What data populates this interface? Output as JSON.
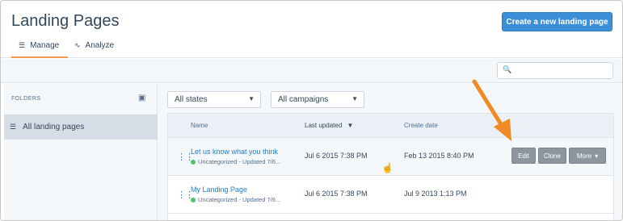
{
  "header": {
    "title": "Landing Pages",
    "create_button": "Create a new landing page",
    "tabs": [
      {
        "label": "Manage",
        "icon": "list-icon",
        "glyph": "☰"
      },
      {
        "label": "Analyze",
        "icon": "activity-icon",
        "glyph": "∿"
      }
    ]
  },
  "toolbar": {
    "search_icon": "🔍",
    "search_placeholder": ""
  },
  "sidebar": {
    "label": "FOLDERS",
    "new_folder_icon": "▣",
    "items": [
      {
        "label": "All landing pages",
        "icon": "☰"
      }
    ]
  },
  "filters": {
    "states": "All states",
    "campaigns": "All campaigns",
    "caret": "▼"
  },
  "table": {
    "columns": {
      "name": "Name",
      "updated": "Last updated",
      "updated_sort": "▼",
      "created": "Create date"
    },
    "rows": [
      {
        "name": "Let us know what you think",
        "meta": "Uncategorized  -  Updated 7/6...",
        "updated": "Jul 6 2015 7:38 PM",
        "created": "Feb 13 2015 8:40 PM"
      },
      {
        "name": "My Landing Page",
        "meta": "Uncategorized  -  Updated 7/6...",
        "updated": "Jul 6 2015 7:38 PM",
        "created": "Jul 9 2013 1:13 PM"
      }
    ],
    "actions": {
      "edit": "Edit",
      "clone": "Clone",
      "more": "More",
      "more_caret": "▾"
    },
    "drag_glyph": "⋮⋮"
  },
  "colors": {
    "primary": "#3b8fd9",
    "link": "#1f7fc4",
    "tab_accent": "#f2994a",
    "annotation_arrow": "#f08a24",
    "status_green": "#4cc56e"
  }
}
